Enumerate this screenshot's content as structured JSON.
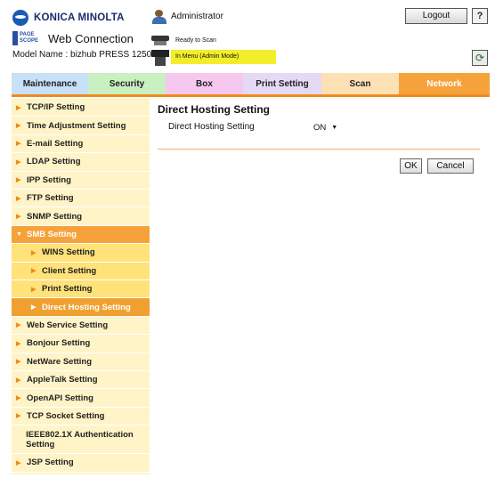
{
  "header": {
    "brand": "KONICA MINOLTA",
    "pws_logo_text": "PAGE SCOPE",
    "app_title": "Web Connection",
    "model": "Model Name : bizhub PRESS 1250",
    "user": "Administrator",
    "logout_label": "Logout",
    "help_label": "?",
    "status": "Ready to Scan",
    "mode": "In Menu (Admin Mode)",
    "refresh_label": "⟳"
  },
  "tabs": [
    {
      "label": "Maintenance",
      "color": "#c8e0f8"
    },
    {
      "label": "Security",
      "color": "#c9f0c0"
    },
    {
      "label": "Box",
      "color": "#f6c8ef"
    },
    {
      "label": "Print Setting",
      "color": "#e6d9f6"
    },
    {
      "label": "Scan",
      "color": "#fde0b4"
    },
    {
      "label": "Network",
      "color": "#f5a23b",
      "active": true
    }
  ],
  "sidebar": {
    "items": [
      {
        "label": "TCP/IP Setting"
      },
      {
        "label": "Time Adjustment Setting"
      },
      {
        "label": "E-mail Setting"
      },
      {
        "label": "LDAP Setting"
      },
      {
        "label": "IPP Setting"
      },
      {
        "label": "FTP Setting"
      },
      {
        "label": "SNMP Setting"
      },
      {
        "label": "SMB Setting",
        "expanded": true
      },
      {
        "label": "WINS Setting",
        "sub": true
      },
      {
        "label": "Client Setting",
        "sub": true
      },
      {
        "label": "Print Setting",
        "sub": true
      },
      {
        "label": "Direct Hosting Setting",
        "sub": true,
        "active": true
      },
      {
        "label": "Web Service Setting"
      },
      {
        "label": "Bonjour Setting"
      },
      {
        "label": "NetWare Setting"
      },
      {
        "label": "AppleTalk Setting"
      },
      {
        "label": "OpenAPI Setting"
      },
      {
        "label": "TCP Socket Setting"
      },
      {
        "label": "IEEE802.1X Authentication Setting"
      },
      {
        "label": "JSP Setting"
      }
    ]
  },
  "main": {
    "title": "Direct Hosting Setting",
    "field_label": "Direct Hosting Setting",
    "field_value": "ON",
    "ok_label": "OK",
    "cancel_label": "Cancel"
  },
  "colors": {
    "accent_orange": "#f28a1a",
    "sidebar_bg": "#fff4c8",
    "mode_highlight": "#f3ee2a"
  }
}
